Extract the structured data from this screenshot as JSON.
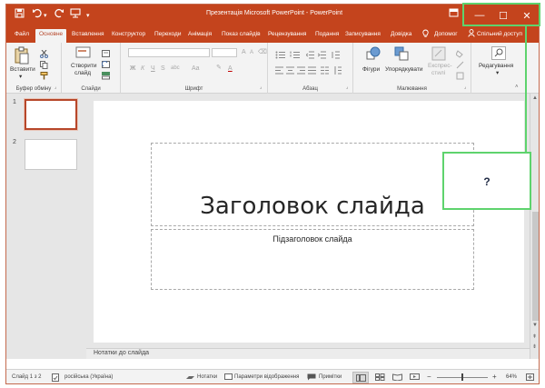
{
  "quick_access": {
    "save_icon": "save-icon",
    "undo_icon": "undo-icon",
    "redo_icon": "redo-icon",
    "present_icon": "present-icon"
  },
  "window": {
    "title": "Презентація Microsoft PowerPoint  -  PowerPoint",
    "minimize": "—",
    "maximize": "☐",
    "close": "✕"
  },
  "tabs": [
    "Файл",
    "Основне",
    "Вставлення",
    "Конструктор",
    "Переходи",
    "Анімація",
    "Показ слайдів",
    "Рецензування",
    "Подання",
    "Записування",
    "Довідка"
  ],
  "tell_me": "Допомог",
  "share": "Спільний доступ",
  "ribbon": {
    "clipboard": {
      "label": "Буфер обміну",
      "paste": "Вставити"
    },
    "slides": {
      "label": "Слайди",
      "new_slide_line1": "Створити",
      "new_slide_line2": "слайд"
    },
    "font": {
      "label": "Шрифт",
      "bold": "Ж",
      "italic": "К",
      "underline": "Ч",
      "strike": "S",
      "spacing": "abc",
      "size_up": "A",
      "size_down": "A",
      "case": "Aa",
      "color": "A"
    },
    "paragraph": {
      "label": "Абзац"
    },
    "drawing": {
      "label": "Малювання",
      "shapes": "Фігури",
      "arrange": "Упорядкувати",
      "quick_styles_1": "Експрес-",
      "quick_styles_2": "стилі"
    },
    "editing": {
      "label": "Редагування"
    }
  },
  "slides_panel": [
    {
      "num": "1"
    },
    {
      "num": "2"
    }
  ],
  "slide": {
    "title": "Заголовок слайда",
    "subtitle": "Підзаголовок слайда"
  },
  "notes": "Нотатки до слайда",
  "status": {
    "slide_info": "Слайд 1 з 2",
    "language": "російська (Україна)",
    "notes": "Нотатки",
    "display": "Параметри відображення",
    "comments": "Примітки",
    "zoom": "64%"
  },
  "overlay": {
    "question": "?"
  }
}
